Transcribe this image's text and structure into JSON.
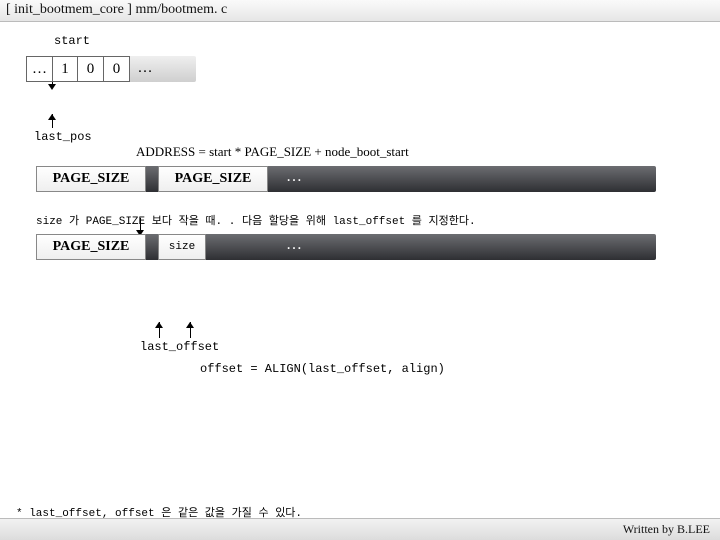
{
  "title": "[ init_bootmem_core ] mm/bootmem. c",
  "labels": {
    "start": "start",
    "last_pos": "last_pos",
    "last_offset": "last_offset"
  },
  "bitmap": {
    "cells": [
      "…",
      "1",
      "0",
      "0",
      "…"
    ]
  },
  "address_formula": "ADDRESS = start * PAGE_SIZE + node_boot_start",
  "page_row1": {
    "a": "PAGE_SIZE",
    "b": "PAGE_SIZE",
    "dots": "…"
  },
  "note_size": "size 가 PAGE_SIZE 보다 작을 때. . 다음 할당을 위해 last_offset 를 지정한다.",
  "page_row2": {
    "a": "PAGE_SIZE",
    "size": "size",
    "dots": "…"
  },
  "offset_formula": "offset = ALIGN(last_offset, align)",
  "footnote": "* last_offset, offset 은 같은 값을 가질 수 있다.",
  "footer": "Written by B.LEE"
}
